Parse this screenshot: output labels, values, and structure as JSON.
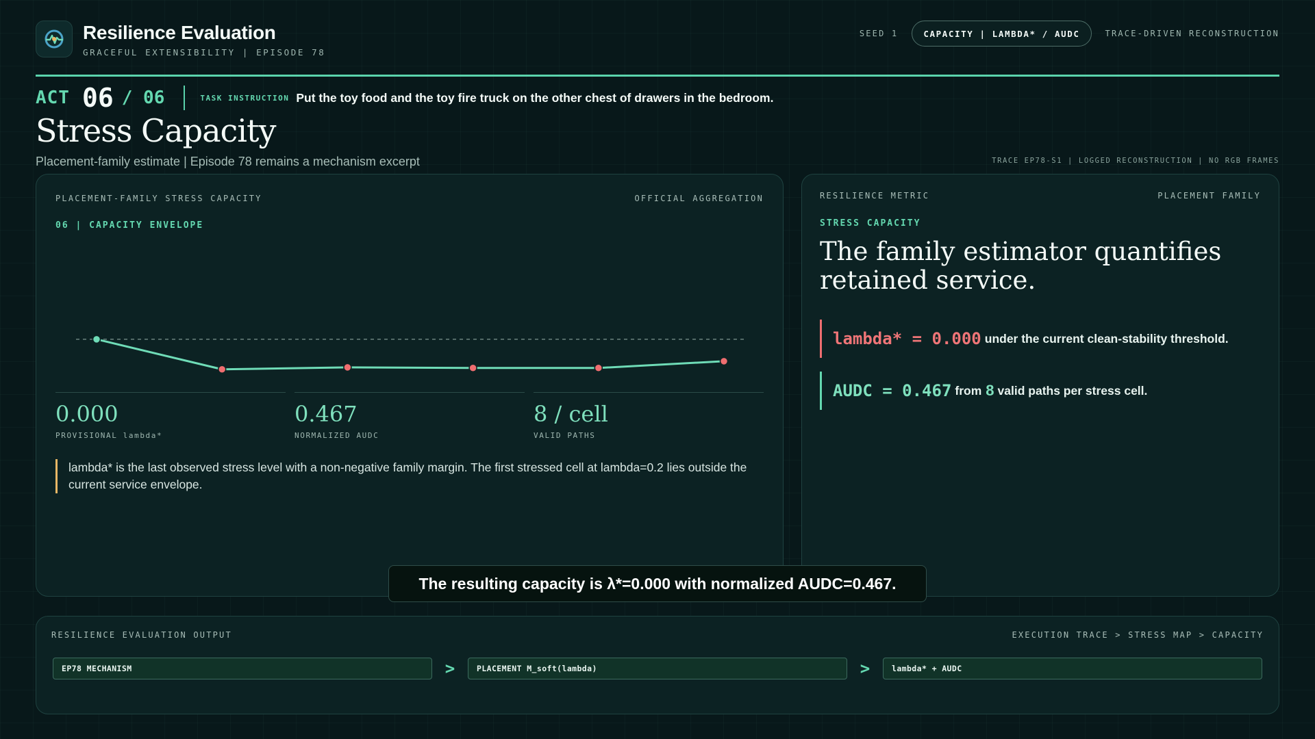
{
  "header": {
    "title": "Resilience Evaluation",
    "subtitle": "GRACEFUL EXTENSIBILITY | EPISODE 78",
    "seed": "SEED 1",
    "pill": "CAPACITY | LAMBDA* / AUDC",
    "mode": "TRACE-DRIVEN RECONSTRUCTION"
  },
  "act": {
    "label": "ACT",
    "current": "06",
    "total": "/ 06",
    "task_label": "TASK INSTRUCTION",
    "task_text": "Put the toy food and the toy fire truck on the other chest of drawers in the bedroom."
  },
  "page": {
    "title": "Stress Capacity",
    "subtitle": "Placement-family estimate | Episode 78 remains a mechanism excerpt",
    "trace_note": "TRACE EP78-S1 | LOGGED RECONSTRUCTION | NO RGB FRAMES"
  },
  "left_panel": {
    "label": "PLACEMENT-FAMILY STRESS CAPACITY",
    "aggregation": "OFFICIAL AGGREGATION",
    "section": "06 | CAPACITY ENVELOPE",
    "stats": [
      {
        "value": "0.000",
        "label": "PROVISIONAL lambda*"
      },
      {
        "value": "0.467",
        "label": "NORMALIZED AUDC"
      },
      {
        "value": "8 / cell",
        "label": "VALID PATHS"
      }
    ],
    "note": "lambda* is the last observed stress level with a non-negative family margin. The first stressed cell at lambda=0.2 lies outside the current service envelope."
  },
  "right_panel": {
    "label": "RESILIENCE METRIC",
    "family": "PLACEMENT FAMILY",
    "section": "STRESS CAPACITY",
    "headline": "The family estimator quantifies retained service.",
    "lambda_code": "lambda* = 0.000",
    "lambda_text": "under the current clean-stability threshold.",
    "audc_code": "AUDC = 0.467",
    "audc_from": "from",
    "audc_num": "8",
    "audc_text": "valid paths per stress cell."
  },
  "caption": "The resulting capacity is λ*=0.000 with normalized AUDC=0.467.",
  "bottom": {
    "label": "RESILIENCE EVALUATION OUTPUT",
    "path": "EXECUTION TRACE > STRESS MAP > CAPACITY",
    "steps": [
      "EP78 MECHANISM",
      "PLACEMENT M_soft(lambda)",
      "lambda* + AUDC"
    ],
    "arrow": ">"
  },
  "chart_data": {
    "type": "line",
    "series": [
      {
        "values": [
          0.0,
          -0.155,
          -0.145,
          -0.148,
          -0.148,
          -0.113
        ],
        "point_status": [
          "ok",
          "fail",
          "fail",
          "fail",
          "fail",
          "fail"
        ]
      }
    ],
    "reference_line": 0.0,
    "ylim": [
      -0.35,
      0.25
    ],
    "colors": {
      "line": "#6fdcb7",
      "ok": "#6fdcb7",
      "fail": "#ef6e70",
      "reference": "#8aa39c"
    }
  }
}
